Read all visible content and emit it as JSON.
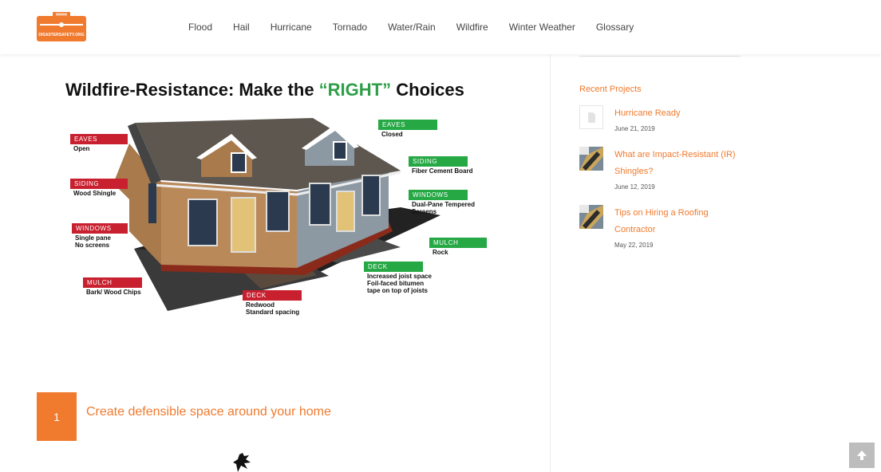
{
  "header": {
    "logo_text": "DISASTERSAFETY.ORG",
    "nav": [
      "Flood",
      "Hail",
      "Hurricane",
      "Tornado",
      "Water/Rain",
      "Wildfire",
      "Winter Weather",
      "Glossary"
    ]
  },
  "article": {
    "title_part1": "Wildfire-Resistance: Make the ",
    "title_highlight": "“RIGHT”",
    "title_part2": " Choices",
    "diagram": {
      "wrong": [
        {
          "tag": "EAVES",
          "desc": "Open"
        },
        {
          "tag": "SIDING",
          "desc": "Wood Shingle"
        },
        {
          "tag": "WINDOWS",
          "desc": "Single pane\nNo screens"
        },
        {
          "tag": "MULCH",
          "desc": "Bark/ Wood Chips"
        },
        {
          "tag": "DECK",
          "desc": "Redwood\nStandard spacing"
        }
      ],
      "right": [
        {
          "tag": "EAVES",
          "desc": "Closed"
        },
        {
          "tag": "SIDING",
          "desc": "Fiber Cement Board"
        },
        {
          "tag": "WINDOWS",
          "desc": "Dual-Pane Tempered\nScreens"
        },
        {
          "tag": "MULCH",
          "desc": "Rock"
        },
        {
          "tag": "DECK",
          "desc": "Increased joist space\nFoil-faced bitumen\ntape on top of joists"
        }
      ]
    },
    "step": {
      "number": "1",
      "text": "Create defensible space around your home"
    }
  },
  "sidebar": {
    "title": "Recent Projects",
    "projects": [
      {
        "title": "Hurricane Ready",
        "date": "June 21, 2019",
        "thumb_icon": "document-icon"
      },
      {
        "title": "What are Impact-Resistant (IR) Shingles?",
        "date": "June 12, 2019",
        "thumb_icon": "shingle-photo"
      },
      {
        "title": "Tips on Hiring a Roofing Contractor",
        "date": "May 22, 2019",
        "thumb_icon": "shingle-photo"
      }
    ]
  },
  "colors": {
    "accent": "#f07a2e",
    "right_green": "#26a845",
    "wrong_red": "#c8202f"
  }
}
